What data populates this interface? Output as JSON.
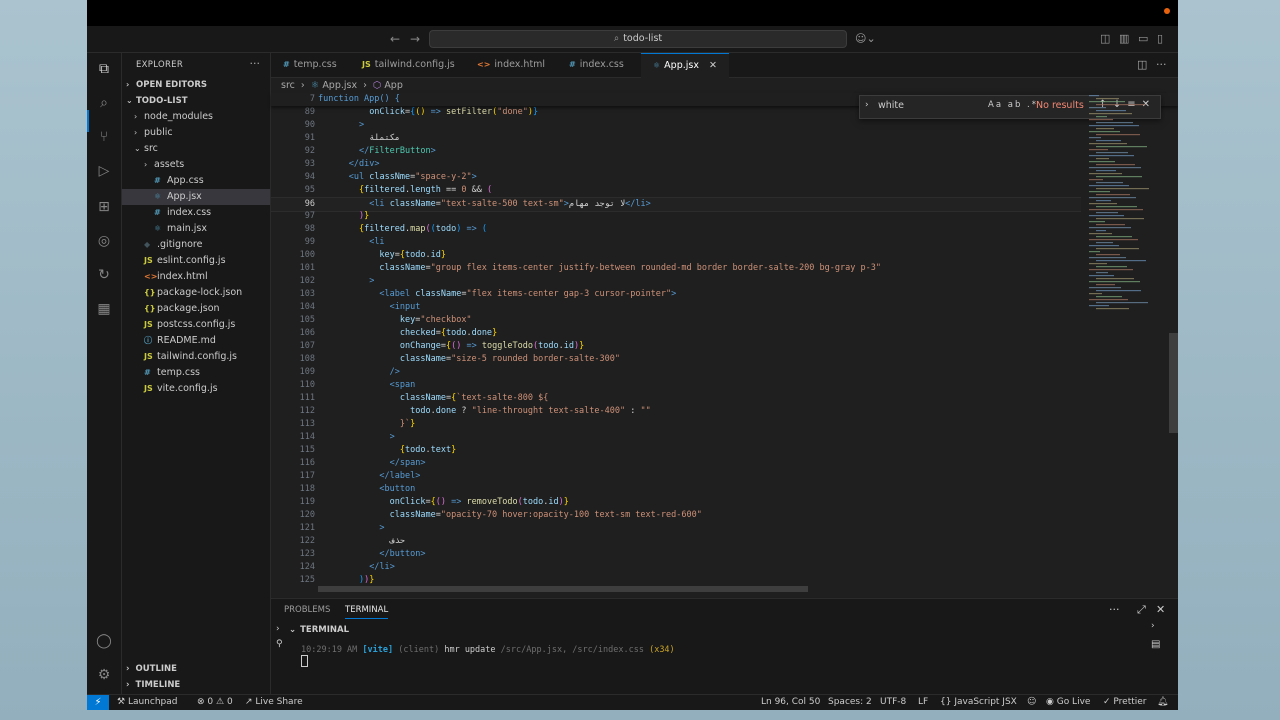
{
  "window": {
    "title": "todo-list"
  },
  "explorer": {
    "title": "EXPLORER",
    "open_editors": "OPEN EDITORS",
    "root": "TODO-LIST",
    "items": [
      {
        "label": "node_modules",
        "kind": "folder",
        "chev": "›",
        "depth": 1
      },
      {
        "label": "public",
        "kind": "folder",
        "chev": "›",
        "depth": 1
      },
      {
        "label": "src",
        "kind": "folder",
        "chev": "⌄",
        "depth": 1
      },
      {
        "label": "assets",
        "kind": "folder",
        "chev": "›",
        "depth": 2
      },
      {
        "label": "App.css",
        "kind": "css",
        "depth": 2
      },
      {
        "label": "App.jsx",
        "kind": "jsx",
        "depth": 2,
        "selected": true
      },
      {
        "label": "index.css",
        "kind": "css",
        "depth": 2
      },
      {
        "label": "main.jsx",
        "kind": "jsx",
        "depth": 2
      },
      {
        "label": ".gitignore",
        "kind": "git",
        "depth": 1
      },
      {
        "label": "eslint.config.js",
        "kind": "js",
        "depth": 1
      },
      {
        "label": "index.html",
        "kind": "html",
        "depth": 1
      },
      {
        "label": "package-lock.json",
        "kind": "json",
        "depth": 1
      },
      {
        "label": "package.json",
        "kind": "json",
        "depth": 1
      },
      {
        "label": "postcss.config.js",
        "kind": "js",
        "depth": 1
      },
      {
        "label": "README.md",
        "kind": "md",
        "depth": 1
      },
      {
        "label": "tailwind.config.js",
        "kind": "js",
        "depth": 1
      },
      {
        "label": "temp.css",
        "kind": "css",
        "depth": 1
      },
      {
        "label": "vite.config.js",
        "kind": "js",
        "depth": 1
      }
    ],
    "outline": "OUTLINE",
    "timeline": "TIMELINE"
  },
  "tabs": [
    {
      "label": "temp.css",
      "icon": "#",
      "color": "#519aba"
    },
    {
      "label": "tailwind.config.js",
      "icon": "JS",
      "color": "#cbcb41"
    },
    {
      "label": "index.html",
      "icon": "<>",
      "color": "#e37933"
    },
    {
      "label": "index.css",
      "icon": "#",
      "color": "#519aba"
    },
    {
      "label": "App.jsx",
      "icon": "⚛",
      "color": "#519aba",
      "active": true
    }
  ],
  "breadcrumb": {
    "folder": "src",
    "file": "App.jsx",
    "symbol": "App"
  },
  "sticky": {
    "line": "7",
    "text": "function App() {"
  },
  "find": {
    "value": "white",
    "case": "Aa",
    "word": "ab",
    "regex": ".*",
    "result": "No results"
  },
  "code": {
    "current_line": "96",
    "lines": [
      {
        "n": "89",
        "html": "          <span class='c-attr'>onClick</span><span class='c-p'>=</span><span class='c-b'>{</span><span class='c-y'>()</span> <span class='c-kw'>=&gt;</span> <span class='c-fn'>setFilter</span><span class='c-y'>(</span><span class='c-str'>\"done\"</span><span class='c-y'>)</span><span class='c-b'>}</span>"
      },
      {
        "n": "90",
        "html": "        <span class='c-tag'>&gt;</span>"
      },
      {
        "n": "91",
        "html": "          <span class='c-txt'>مكتملة</span>"
      },
      {
        "n": "92",
        "html": "        <span class='c-tag'>&lt;/</span><span class='c-comp'>FilterButton</span><span class='c-tag'>&gt;</span>"
      },
      {
        "n": "93",
        "html": "      <span class='c-tag'>&lt;/</span><span class='c-tag'>div</span><span class='c-tag'>&gt;</span>"
      },
      {
        "n": "94",
        "html": "      <span class='c-tag'>&lt;</span><span class='c-tag'>ul</span> <span class='c-attr'>classNme</span><span class='c-p'>=</span><span class='c-str'>\"space-y-2\"</span><span class='c-tag'>&gt;</span>"
      },
      {
        "n": "95",
        "html": "        <span class='c-y'>{</span><span class='c-var'>filtered</span><span class='c-p'>.</span><span class='c-var'>length</span> <span class='c-p'>==</span> <span class='c-str'>0</span> <span class='c-p'>&amp;&amp;</span> <span class='c-m'>(</span>"
      },
      {
        "n": "96",
        "html": "          <span class='c-tag'>&lt;</span><span class='c-tag'>li</span> <span class='c-attr'>className</span><span class='c-p'>=</span><span class='c-str'>\"text-salte-500 text-sm\"</span><span class='c-tag'>&gt;</span><span class='c-txt'>لا توجد مهام</span><span class='c-tag'>&lt;/</span><span class='c-tag'>li</span><span class='c-tag'>&gt;</span>"
      },
      {
        "n": "97",
        "html": "        <span class='c-m'>)</span><span class='c-y'>}</span>"
      },
      {
        "n": "98",
        "html": "        <span class='c-y'>{</span><span class='c-var'>filtered</span><span class='c-p'>.</span><span class='c-fn'>map</span><span class='c-m'>(</span><span class='c-b'>(</span><span class='c-var'>todo</span><span class='c-b'>)</span> <span class='c-kw'>=&gt;</span> <span class='c-b'>(</span>"
      },
      {
        "n": "99",
        "html": "          <span class='c-tag'>&lt;</span><span class='c-tag'>li</span>"
      },
      {
        "n": "100",
        "html": "            <span class='c-attr'>key</span><span class='c-p'>=</span><span class='c-y'>{</span><span class='c-var'>todo</span><span class='c-p'>.</span><span class='c-var'>id</span><span class='c-y'>}</span>"
      },
      {
        "n": "101",
        "html": "            <span class='c-attr'>className</span><span class='c-p'>=</span><span class='c-str'>\"group flex items-center justify-between rounded-md border border-salte-200 bg-gray p-3\"</span>"
      },
      {
        "n": "102",
        "html": "          <span class='c-tag'>&gt;</span>"
      },
      {
        "n": "103",
        "html": "            <span class='c-tag'>&lt;</span><span class='c-tag'>label</span> <span class='c-attr'>className</span><span class='c-p'>=</span><span class='c-str'>\"flex items-center gap-3 cursor-pointer\"</span><span class='c-tag'>&gt;</span>"
      },
      {
        "n": "104",
        "html": "              <span class='c-tag'>&lt;</span><span class='c-tag'>input</span>"
      },
      {
        "n": "105",
        "html": "                <span class='c-attr'>key</span><span class='c-p'>=</span><span class='c-str'>\"checkbox\"</span>"
      },
      {
        "n": "106",
        "html": "                <span class='c-attr'>checked</span><span class='c-p'>=</span><span class='c-y'>{</span><span class='c-var'>todo</span><span class='c-p'>.</span><span class='c-var'>done</span><span class='c-y'>}</span>"
      },
      {
        "n": "107",
        "html": "                <span class='c-attr'>onChange</span><span class='c-p'>=</span><span class='c-y'>{</span><span class='c-m'>()</span> <span class='c-kw'>=&gt;</span> <span class='c-fn'>toggleTodo</span><span class='c-m'>(</span><span class='c-var'>todo</span><span class='c-p'>.</span><span class='c-var'>id</span><span class='c-m'>)</span><span class='c-y'>}</span>"
      },
      {
        "n": "108",
        "html": "                <span class='c-attr'>className</span><span class='c-p'>=</span><span class='c-str'>\"size-5 rounded border-salte-300\"</span>"
      },
      {
        "n": "109",
        "html": "              <span class='c-tag'>/&gt;</span>"
      },
      {
        "n": "110",
        "html": "              <span class='c-tag'>&lt;</span><span class='c-tag'>span</span>"
      },
      {
        "n": "111",
        "html": "                <span class='c-attr'>className</span><span class='c-p'>=</span><span class='c-y'>{</span><span class='c-str'>`text-salte-800 ${</span>"
      },
      {
        "n": "112",
        "html": "                  <span class='c-var'>todo</span><span class='c-p'>.</span><span class='c-var'>done</span> <span class='c-p'>?</span> <span class='c-str'>\"line-throught text-salte-400\"</span> <span class='c-p'>:</span> <span class='c-str'>\"\"</span>"
      },
      {
        "n": "113",
        "html": "                <span class='c-str'>}`</span><span class='c-y'>}</span>"
      },
      {
        "n": "114",
        "html": "              <span class='c-tag'>&gt;</span>"
      },
      {
        "n": "115",
        "html": "                <span class='c-y'>{</span><span class='c-var'>todo</span><span class='c-p'>.</span><span class='c-var'>text</span><span class='c-y'>}</span>"
      },
      {
        "n": "116",
        "html": "              <span class='c-tag'>&lt;/</span><span class='c-tag'>span</span><span class='c-tag'>&gt;</span>"
      },
      {
        "n": "117",
        "html": "            <span class='c-tag'>&lt;/</span><span class='c-tag'>label</span><span class='c-tag'>&gt;</span>"
      },
      {
        "n": "118",
        "html": "            <span class='c-tag'>&lt;</span><span class='c-tag'>button</span>"
      },
      {
        "n": "119",
        "html": "              <span class='c-attr'>onClick</span><span class='c-p'>=</span><span class='c-y'>{</span><span class='c-m'>()</span> <span class='c-kw'>=&gt;</span> <span class='c-fn'>removeTodo</span><span class='c-m'>(</span><span class='c-var'>todo</span><span class='c-p'>.</span><span class='c-var'>id</span><span class='c-m'>)</span><span class='c-y'>}</span>"
      },
      {
        "n": "120",
        "html": "              <span class='c-attr'>className</span><span class='c-p'>=</span><span class='c-str'>\"opacity-70 hover:opacity-100 text-sm text-red-600\"</span>"
      },
      {
        "n": "121",
        "html": "            <span class='c-tag'>&gt;</span>"
      },
      {
        "n": "122",
        "html": "              <span class='c-txt'>حذف</span>"
      },
      {
        "n": "123",
        "html": "            <span class='c-tag'>&lt;/</span><span class='c-tag'>button</span><span class='c-tag'>&gt;</span>"
      },
      {
        "n": "124",
        "html": "          <span class='c-tag'>&lt;/</span><span class='c-tag'>li</span><span class='c-tag'>&gt;</span>"
      },
      {
        "n": "125",
        "html": "        <span class='c-b'>)</span><span class='c-m'>)</span><span class='c-y'>}</span>"
      }
    ]
  },
  "panel": {
    "tabs": [
      "PROBLEMS",
      "TERMINAL"
    ],
    "active": "TERMINAL",
    "terminal_title": "TERMINAL",
    "log": {
      "time": "10:29:19 AM",
      "tag": "[vite]",
      "client": "(client)",
      "msg": "hmr update",
      "files": "/src/App.jsx, /src/index.css",
      "count": "(x34)"
    }
  },
  "status": {
    "launchpad": "Launchpad",
    "errors": "0",
    "warnings": "0",
    "liveshare": "Live Share",
    "position": "Ln 96, Col 50",
    "spaces": "Spaces: 2",
    "encoding": "UTF-8",
    "eol": "LF",
    "language": "JavaScript JSX",
    "golive": "Go Live",
    "prettier": "Prettier"
  },
  "colors": {
    "accent": "#0078d4",
    "find_no_results": "#f48771"
  }
}
